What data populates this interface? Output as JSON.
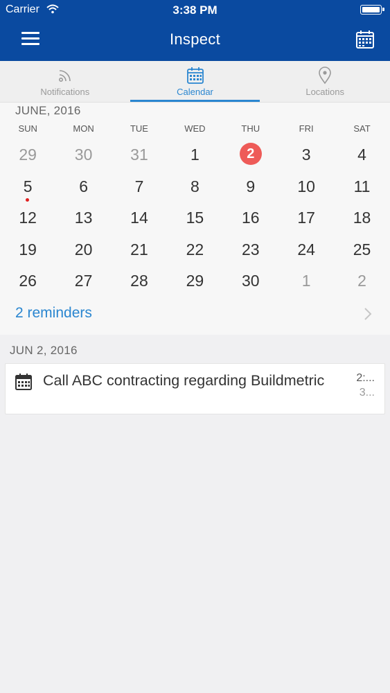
{
  "status_bar": {
    "carrier": "Carrier",
    "time": "3:38 PM"
  },
  "nav": {
    "title": "Inspect"
  },
  "tabs": [
    {
      "label": "Notifications",
      "icon": "rss-icon",
      "active": false
    },
    {
      "label": "Calendar",
      "icon": "calendar-icon",
      "active": true
    },
    {
      "label": "Locations",
      "icon": "location-pin-icon",
      "active": false
    }
  ],
  "calendar": {
    "month_title": "JUNE, 2016",
    "weekdays": [
      "SUN",
      "MON",
      "TUE",
      "WED",
      "THU",
      "FRI",
      "SAT"
    ],
    "weeks": [
      [
        "29",
        "30",
        "31",
        "1",
        "2",
        "3",
        "4"
      ],
      [
        "5",
        "6",
        "7",
        "8",
        "9",
        "10",
        "11"
      ],
      [
        "12",
        "13",
        "14",
        "15",
        "16",
        "17",
        "18"
      ],
      [
        "19",
        "20",
        "21",
        "22",
        "23",
        "24",
        "25"
      ],
      [
        "26",
        "27",
        "28",
        "29",
        "30",
        "1",
        "2"
      ]
    ],
    "today": "2",
    "event_marker_day": "5",
    "accent_color": "#2a86d0",
    "today_color": "#ee5b58"
  },
  "reminders": {
    "label": "2 reminders"
  },
  "agenda": {
    "date": "JUN 2, 2016",
    "items": [
      {
        "title": "Call ABC contracting regarding Buildmetric",
        "time_start": "2:...",
        "time_end": "3..."
      }
    ]
  },
  "colors": {
    "header_bg": "#0a4aa0",
    "page_bg": "#f0f0f2"
  }
}
